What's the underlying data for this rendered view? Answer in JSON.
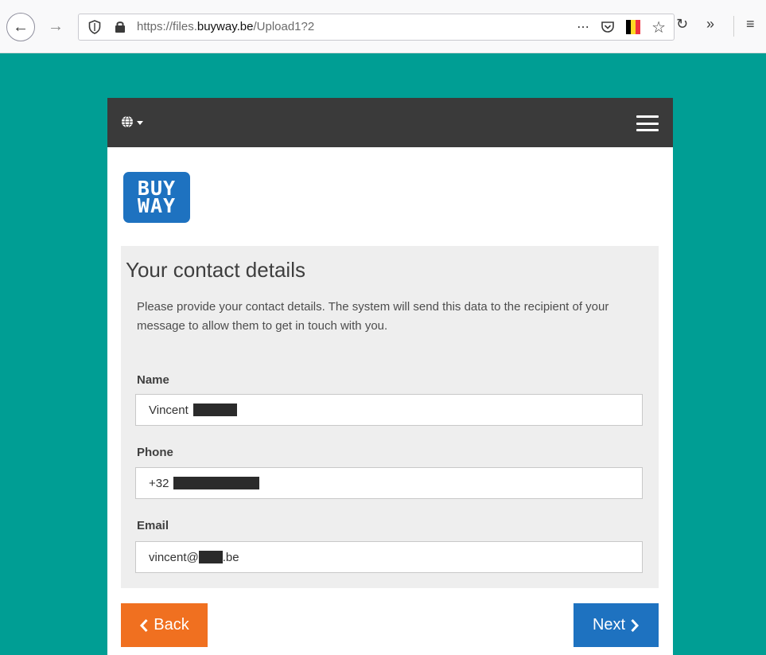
{
  "browser": {
    "url_prefix": "https://files.",
    "url_domain": "buyway.be",
    "url_path": "/Upload1?2",
    "icons": [
      "back-arrow-icon",
      "forward-arrow-icon",
      "shield-icon",
      "lock-icon",
      "more-icon",
      "pocket-icon",
      "belgium-flag-icon",
      "star-icon",
      "reload-icon",
      "overflow-icon",
      "menu-icon"
    ],
    "flag_colors": [
      "#000000",
      "#fdda24",
      "#ef3340"
    ]
  },
  "nav": {
    "icons": [
      "globe-icon",
      "caret-down-icon",
      "hamburger-menu-icon"
    ]
  },
  "logo": {
    "line1": "BUY",
    "line2": "WAY",
    "color": "#1e72c0"
  },
  "form": {
    "title": "Your contact details",
    "description": "Please provide your contact details. The system will send this data to the recipient of your message to allow them to get in touch with you.",
    "fields": [
      {
        "label": "Name",
        "value_prefix": "Vincent",
        "value_suffix": ""
      },
      {
        "label": "Phone",
        "value_prefix": "+32",
        "value_suffix": ""
      },
      {
        "label": "Email",
        "value_prefix": "vincent@",
        "value_suffix": ".be"
      }
    ]
  },
  "buttons": {
    "back_label": "Back",
    "next_label": "Next",
    "back_color": "#f07020",
    "next_color": "#1e72c0"
  },
  "colors": {
    "page_background": "#009e94",
    "navbar": "#3a3a3a",
    "panel": "#eeeeee"
  }
}
